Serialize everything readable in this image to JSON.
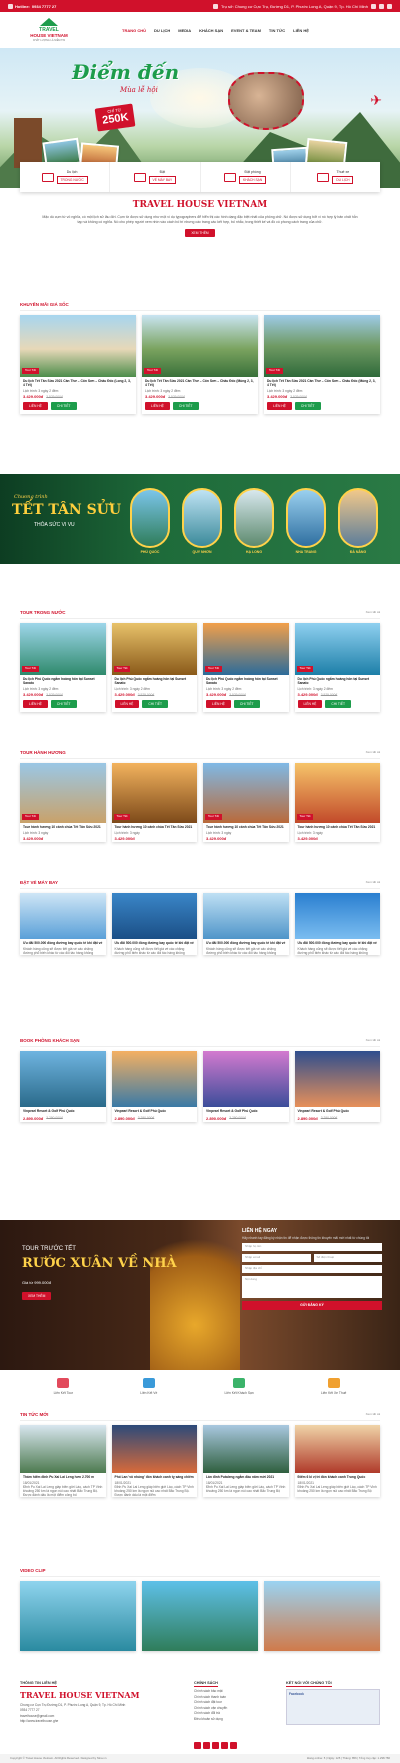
{
  "topbar": {
    "hotline_label": "Hotline:",
    "hotline": "0934 7777 27",
    "address": "Trụ sở: Chung cư Cực Trụ, Đường D1, P. Phước Long A, Quận 9, Tp. Hồ Chí Minh"
  },
  "logo": {
    "line1": "TRAVEL",
    "line2": "HOUSE",
    "line3": "VIETNAM",
    "tagline": "CHẤT LƯỢNG LÀ NIỀM TIN"
  },
  "nav": [
    "TRANG CHỦ",
    "DU LỊCH",
    "MEDIA",
    "KHÁCH SẠN",
    "EVENT & TEAM",
    "TIN TỨC",
    "LIÊN HỆ"
  ],
  "hero": {
    "title": "Điểm đến",
    "subtitle": "Mùa lễ hội",
    "price_label": "CHỈ TỪ",
    "price": "250K"
  },
  "services": [
    {
      "top": "Du lịch",
      "btn": "TRONG NƯỚC"
    },
    {
      "top": "Đặt",
      "btn": "VÉ MÁY BAY"
    },
    {
      "top": "Đặt phòng",
      "btn": "KHÁCH SẠN"
    },
    {
      "top": "Thuê xe",
      "btn": "DU LỊCH"
    }
  ],
  "intro": {
    "title": "TRAVEL HOUSE VIETNAM",
    "text": "Mặc dù cụm từ vô nghĩa, có một lịch sử lâu đời. Cụm từ được sử dụng như một ví dụ typographers để hiển thị các hình dạng đặc biệt nhất của phông chữ. Nó được sử dụng bởi vì nó hợp lý bản chất hỗn tạp và không có nghĩa. Nó cho phép người xem nhìn vào cách bố trí nhưng các trang các kết hợp, bố nhắc, trong thiết kế và đồ có phong cách trang của chữ.",
    "btn": "XEM THÊM"
  },
  "promo_section": {
    "title": "KHUYẾN MÃI GIÁ SỐC",
    "cards": [
      {
        "tag": "Tour Tết",
        "name": "Du lịch Tết Tân Sửu 2021 Cần Thơ – Côn Sơn – Châu Đốc (Long 2, 3, 4 Tết)",
        "meta": "Lịch trình: 3 ngày 2 đêm",
        "price": "3.429.000đ",
        "old": "3.529.000đ"
      },
      {
        "tag": "Tour Tết",
        "name": "Du lịch Tết Tân Sửu 2021 Cần Thơ – Côn Sơn – Châu Đốc (Mùng 2, 3, 4 Tết)",
        "meta": "Lịch trình: 3 ngày 2 đêm",
        "price": "3.429.000đ",
        "old": "3.529.000đ"
      },
      {
        "tag": "Tour Tết",
        "name": "Du lịch Tết Tân Sửu 2021 Cần Thơ – Côn Sơn – Châu Đốc (Mùng 2, 3, 4 Tết)",
        "meta": "Lịch trình: 3 ngày 2 đêm",
        "price": "3.429.000đ",
        "old": "3.529.000đ"
      }
    ],
    "btn1": "LIÊN HỆ",
    "btn2": "CHI TIẾT"
  },
  "tet": {
    "small": "Chương trình",
    "title": "TẾT TÂN SỬU",
    "sub": "THỎA SỨC VI VU",
    "places": [
      "PHÚ QUỐC",
      "QUY NHƠN",
      "HẠ LONG",
      "NHA TRANG",
      "ĐÀ NẴNG"
    ]
  },
  "domestic": {
    "title": "TOUR TRONG NƯỚC",
    "more": "Xem tất cả",
    "cards": [
      {
        "tag": "Tour Tết",
        "name": "Du lịch Phú Quốc ngắm hoàng hôn tại Sunset Sanato",
        "meta": "Lịch trình: 3 ngày 2 đêm",
        "price": "3.429.000đ",
        "old": "3.529.000đ"
      },
      {
        "tag": "Tour Tết",
        "name": "Du lịch Phú Quốc ngắm hoàng hôn tại Sunset Sanato",
        "meta": "Lịch trình: 3 ngày 2 đêm",
        "price": "3.429.000đ",
        "old": "3.529.000đ"
      },
      {
        "tag": "Tour Tết",
        "name": "Du lịch Phú Quốc ngắm hoàng hôn tại Sunset Sanato",
        "meta": "Lịch trình: 3 ngày 2 đêm",
        "price": "3.429.000đ",
        "old": "3.529.000đ"
      },
      {
        "tag": "Tour Tết",
        "name": "Du lịch Phú Quốc ngắm hoàng hôn tại Sunset Sanato",
        "meta": "Lịch trình: 3 ngày 2 đêm",
        "price": "3.429.000đ",
        "old": "3.529.000đ"
      }
    ]
  },
  "pilgrim": {
    "title": "TOUR HÀNH HƯƠNG",
    "more": "Xem tất cả",
    "cards": [
      {
        "tag": "Tour Tết",
        "name": "Tour hành hương 10 cảnh chùa Tết Tân Sửu 2021",
        "meta": "Lịch trình: 3 ngày",
        "price": "3.429.000đ",
        "old": ""
      },
      {
        "tag": "Tour Tết",
        "name": "Tour hành hương 10 cảnh chùa Tết Tân Sửu 2021",
        "meta": "Lịch trình: 3 ngày",
        "price": "3.429.000đ",
        "old": ""
      },
      {
        "tag": "Tour Tết",
        "name": "Tour hành hương 10 cảnh chùa Tết Tân Sửu 2021",
        "meta": "Lịch trình: 3 ngày",
        "price": "3.429.000đ",
        "old": ""
      },
      {
        "tag": "Tour Tết",
        "name": "Tour hành hương 10 cảnh chùa Tết Tân Sửu 2021",
        "meta": "Lịch trình: 3 ngày",
        "price": "3.429.000đ",
        "old": ""
      }
    ]
  },
  "flights": {
    "title": "ĐẶT VÉ MÁY BAY",
    "more": "Xem tất cả",
    "cards": [
      {
        "name": "Ưu đãi 500.000 đồng đường bay quốc tế khi đặt vé",
        "desc": "Khách hàng cũng sẽ được tiết giá vé các chặng đường phổ biến khác từ các đối tác hàng không"
      },
      {
        "name": "Ưu đãi 500.000 đồng đường bay quốc tế khi đặt vé",
        "desc": "Khách hàng cũng sẽ được tiết giá vé các chặng đường phổ biến khác từ các đối tác hàng không"
      },
      {
        "name": "Ưu đãi 500.000 đồng đường bay quốc tế khi đặt vé",
        "desc": "Khách hàng cũng sẽ được tiết giá vé các chặng đường phổ biến khác từ các đối tác hàng không"
      },
      {
        "name": "Ưu đãi 500.000 đồng đường bay quốc tế khi đặt vé",
        "desc": "Khách hàng cũng sẽ được tiết giá vé các chặng đường phổ biến khác từ các đối tác hàng không"
      }
    ]
  },
  "hotels": {
    "title": "BOOK PHÒNG KHÁCH SẠN",
    "more": "Xem tất cả",
    "cards": [
      {
        "name": "Vinpearl Resort & Golf Phú Quốc",
        "price": "2.890.000đ",
        "old": "3.290.000đ"
      },
      {
        "name": "Vinpearl Resort & Golf Phú Quốc",
        "price": "2.890.000đ",
        "old": "3.290.000đ"
      },
      {
        "name": "Vinpearl Resort & Golf Phú Quốc",
        "price": "2.890.000đ",
        "old": "3.290.000đ"
      },
      {
        "name": "Vinpearl Resort & Golf Phú Quốc",
        "price": "2.890.000đ",
        "old": "3.290.000đ"
      }
    ]
  },
  "promo_banner": {
    "t1": "TOUR TRƯỚC TẾT",
    "t2": "RƯỚC XUÂN VỀ NHÀ",
    "t3": "Giá từ 999.000đ",
    "btn": "XEM THÊM"
  },
  "contact_form": {
    "title": "LIÊN HỆ NGAY",
    "desc": "Hãy nhanh tay đăng ký nhận tin để nhận được thông tin khuyến mãi mới nhất từ chúng tôi",
    "name": "Nhập họ tên",
    "email": "Nhập email",
    "phone": "Số điện thoại",
    "address": "Nhập địa chỉ",
    "message": "Nội dung",
    "submit": "GỬI ĐĂNG KÝ"
  },
  "features": [
    "Liên Kết Tour",
    "Liên Kết Vé",
    "Liên Kết Khách Sạn",
    "Liên Kết Xe Thuê"
  ],
  "news": {
    "title": "TIN TỨC MỚI",
    "more": "Xem tất cả",
    "cards": [
      {
        "name": "Thám hiểm đỉnh Pu Xai Lai Leng hơn 2.700 m",
        "date": "18/01/2021",
        "desc": "Đỉnh Pu Xai Lai Leng giáp biên giới Lào, cách TP Vinh khoảng 250 km là ngọn núi cao nhất Bắc Trung Bộ. Được đánh dấu là một điểm công bố"
      },
      {
        "name": "Phố Lan 'vô nhúng' đón khách canh tỵ sáng chiêm",
        "date": "18/01/2021",
        "desc": "Đỉnh Pu Xai Lai Leng giáp biên giới Lào, cách TP Vinh khoảng 250 km là ngọn núi cao nhất Bắc Trung Bộ. Được đánh dấu là một điểm"
      },
      {
        "name": "Lần đỉnh Putaleng ngắm đầu năm mới 2021",
        "date": "18/01/2021",
        "desc": "Đỉnh Pu Xai Lai Leng giáp biên giới Lào, cách TP Vinh khoảng 250 km là ngọn núi cao nhất Bắc Trung Bộ"
      },
      {
        "name": "Điểm 6 kỉ vị trí đón khách canh Trung Quốc",
        "date": "18/01/2021",
        "desc": "Đỉnh Pu Xai Lai Leng giáp biên giới Lào, cách TP Vinh khoảng 250 km là ngọn núi cao nhất Bắc Trung Bộ"
      }
    ]
  },
  "video": {
    "title": "VIDEO CLIP"
  },
  "footer": {
    "contact_title": "THÔNG TIN LIÊN HỆ",
    "brand": "TRAVEL HOUSE VIETNAM",
    "address": "Chung cư Cực Trụ Đường D1, P. Phước Long A, Quận 9, Tp. Hồ Chí Minh",
    "phone": "0934 7777 27",
    "email": "travelhouse@gmail.com",
    "web": "http://www.travelhouse.ghe",
    "policy_title": "CHÍNH SÁCH",
    "policy": [
      "Chính sách bảo mật",
      "Chính sách thanh toán",
      "Chính sách đặt tour",
      "Chính sách vận chuyển",
      "Chính sách đổi trả",
      "Điều khoản sử dụng"
    ],
    "social_title": "KẾT NỐI VỚI CHÚNG TÔI",
    "fb": "Facebook",
    "copyright": "Copyright © Travel House Vietnam. All Rights Reserved. Designed by Nina.vn",
    "stats": "Đang online: 5 | Ngày: 125 | Tháng: 856 | Tổng truy cập: 1.298.780"
  }
}
